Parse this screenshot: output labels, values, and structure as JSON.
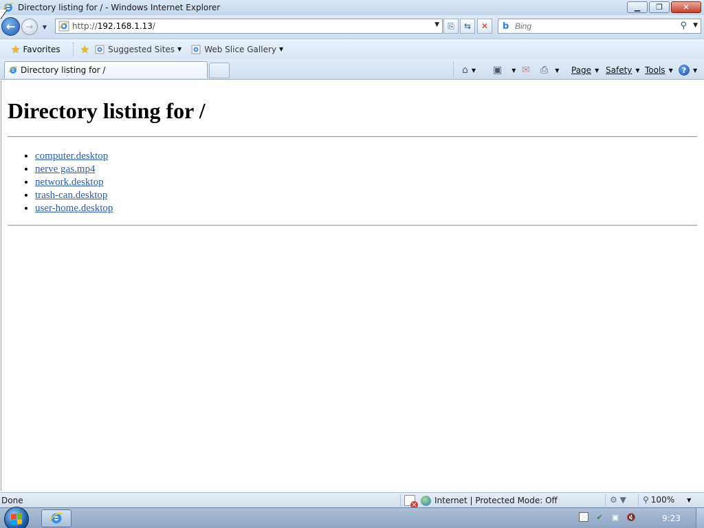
{
  "window": {
    "title": "Directory listing for / - Windows Internet Explorer",
    "minimize_label": "▁",
    "maximize_label": "❐",
    "close_label": "✕"
  },
  "navbar": {
    "url_prefix": "http://",
    "url_host": "192.168.1.13",
    "url_suffix": "/",
    "search_placeholder": "Bing"
  },
  "favorites_bar": {
    "favorites_label": "Favorites",
    "items": [
      {
        "label": "Suggested Sites"
      },
      {
        "label": "Web Slice Gallery"
      }
    ]
  },
  "tabs": [
    {
      "title": "Directory listing for /"
    }
  ],
  "command_bar": {
    "page_label": "Page",
    "safety_label": "Safety",
    "tools_label": "Tools",
    "help_label": "?"
  },
  "page": {
    "heading": "Directory listing for /",
    "files": [
      "computer.desktop",
      "nerve gas.mp4",
      "network.desktop",
      "trash-can.desktop",
      "user-home.desktop"
    ]
  },
  "status_bar": {
    "status": "Done",
    "zone": "Internet | Protected Mode: Off",
    "zoom": "100%"
  },
  "taskbar": {
    "clock": "9:23"
  },
  "colors": {
    "link": "#2a5caa",
    "accent": "#1e5bb5"
  }
}
